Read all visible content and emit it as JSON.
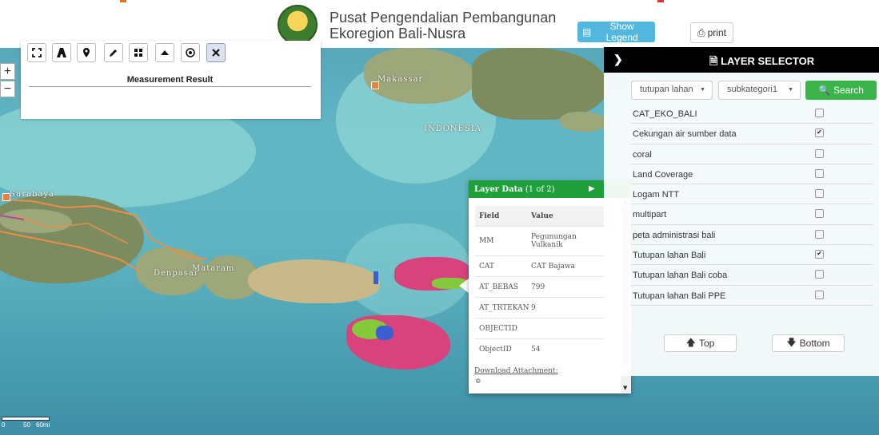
{
  "header": {
    "title_line1": "Pusat Pengendalian Pembangunan",
    "title_line2": "Ekoregion Bali-Nusra",
    "legend_button": "Show Legend",
    "print_button": "print"
  },
  "map": {
    "zoom_in": "+",
    "zoom_out": "−",
    "labels": {
      "makassar": "Makassar",
      "indonesia": "INDONESIA",
      "surabaya": "Surabaya",
      "mataram": "Mataram",
      "denpasar": "Denpasar"
    },
    "scale": {
      "zero": "0",
      "mid": "50",
      "end": "60mi"
    }
  },
  "measurement": {
    "title": "Measurement Result",
    "tools": [
      "fullscreen-icon",
      "road-icon",
      "map-marker-icon",
      "pencil-icon",
      "grid-icon",
      "triangle-up-icon",
      "target-icon",
      "close-icon"
    ]
  },
  "popup": {
    "title": "Layer Data",
    "count": "(1 of 2)",
    "col_field": "Field",
    "col_value": "Value",
    "rows": [
      {
        "field": "MM",
        "value": "Pegunungan Vulkanik"
      },
      {
        "field": "CAT",
        "value": "CAT Bajawa"
      },
      {
        "field": "AT_BEBAS",
        "value": "799"
      },
      {
        "field": "AT_TRTEKAN",
        "value": "9"
      },
      {
        "field": "OBJECTID",
        "value": ""
      },
      {
        "field": "ObjectID",
        "value": "54"
      }
    ],
    "download": "Download Attachment:"
  },
  "layer_selector": {
    "title": "LAYER SELECTOR",
    "select1": "tutupan lahan",
    "select2": "subkategori1",
    "search": "Search",
    "layers": [
      {
        "name": "CAT_EKO_BALI",
        "checked": false
      },
      {
        "name": "Cekungan air sumber data",
        "checked": true
      },
      {
        "name": "coral",
        "checked": false
      },
      {
        "name": "Land Coverage",
        "checked": false
      },
      {
        "name": "Logam NTT",
        "checked": false
      },
      {
        "name": "multipart",
        "checked": false
      },
      {
        "name": "peta administrasi bali",
        "checked": false
      },
      {
        "name": "Tutupan lahan Bali",
        "checked": true
      },
      {
        "name": "Tutupan lahan Bali coba",
        "checked": false
      },
      {
        "name": "Tutupan lahan Bali PPE",
        "checked": false
      }
    ],
    "top_button": "Top",
    "bottom_button": "Bottom"
  },
  "colors": {
    "accent_green": "#3bb54a",
    "popup_header": "#1fa03a",
    "legend_blue": "#53b8df",
    "selector_header": "#000000"
  }
}
